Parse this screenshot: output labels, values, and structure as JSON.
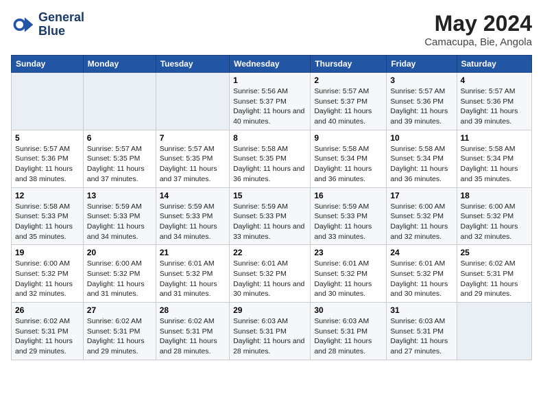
{
  "header": {
    "logo_line1": "General",
    "logo_line2": "Blue",
    "title": "May 2024",
    "subtitle": "Camacupa, Bie, Angola"
  },
  "days_of_week": [
    "Sunday",
    "Monday",
    "Tuesday",
    "Wednesday",
    "Thursday",
    "Friday",
    "Saturday"
  ],
  "weeks": [
    [
      {
        "day": "",
        "info": ""
      },
      {
        "day": "",
        "info": ""
      },
      {
        "day": "",
        "info": ""
      },
      {
        "day": "1",
        "info": "Sunrise: 5:56 AM\nSunset: 5:37 PM\nDaylight: 11 hours and 40 minutes."
      },
      {
        "day": "2",
        "info": "Sunrise: 5:57 AM\nSunset: 5:37 PM\nDaylight: 11 hours and 40 minutes."
      },
      {
        "day": "3",
        "info": "Sunrise: 5:57 AM\nSunset: 5:36 PM\nDaylight: 11 hours and 39 minutes."
      },
      {
        "day": "4",
        "info": "Sunrise: 5:57 AM\nSunset: 5:36 PM\nDaylight: 11 hours and 39 minutes."
      }
    ],
    [
      {
        "day": "5",
        "info": "Sunrise: 5:57 AM\nSunset: 5:36 PM\nDaylight: 11 hours and 38 minutes."
      },
      {
        "day": "6",
        "info": "Sunrise: 5:57 AM\nSunset: 5:35 PM\nDaylight: 11 hours and 37 minutes."
      },
      {
        "day": "7",
        "info": "Sunrise: 5:57 AM\nSunset: 5:35 PM\nDaylight: 11 hours and 37 minutes."
      },
      {
        "day": "8",
        "info": "Sunrise: 5:58 AM\nSunset: 5:35 PM\nDaylight: 11 hours and 36 minutes."
      },
      {
        "day": "9",
        "info": "Sunrise: 5:58 AM\nSunset: 5:34 PM\nDaylight: 11 hours and 36 minutes."
      },
      {
        "day": "10",
        "info": "Sunrise: 5:58 AM\nSunset: 5:34 PM\nDaylight: 11 hours and 36 minutes."
      },
      {
        "day": "11",
        "info": "Sunrise: 5:58 AM\nSunset: 5:34 PM\nDaylight: 11 hours and 35 minutes."
      }
    ],
    [
      {
        "day": "12",
        "info": "Sunrise: 5:58 AM\nSunset: 5:33 PM\nDaylight: 11 hours and 35 minutes."
      },
      {
        "day": "13",
        "info": "Sunrise: 5:59 AM\nSunset: 5:33 PM\nDaylight: 11 hours and 34 minutes."
      },
      {
        "day": "14",
        "info": "Sunrise: 5:59 AM\nSunset: 5:33 PM\nDaylight: 11 hours and 34 minutes."
      },
      {
        "day": "15",
        "info": "Sunrise: 5:59 AM\nSunset: 5:33 PM\nDaylight: 11 hours and 33 minutes."
      },
      {
        "day": "16",
        "info": "Sunrise: 5:59 AM\nSunset: 5:33 PM\nDaylight: 11 hours and 33 minutes."
      },
      {
        "day": "17",
        "info": "Sunrise: 6:00 AM\nSunset: 5:32 PM\nDaylight: 11 hours and 32 minutes."
      },
      {
        "day": "18",
        "info": "Sunrise: 6:00 AM\nSunset: 5:32 PM\nDaylight: 11 hours and 32 minutes."
      }
    ],
    [
      {
        "day": "19",
        "info": "Sunrise: 6:00 AM\nSunset: 5:32 PM\nDaylight: 11 hours and 32 minutes."
      },
      {
        "day": "20",
        "info": "Sunrise: 6:00 AM\nSunset: 5:32 PM\nDaylight: 11 hours and 31 minutes."
      },
      {
        "day": "21",
        "info": "Sunrise: 6:01 AM\nSunset: 5:32 PM\nDaylight: 11 hours and 31 minutes."
      },
      {
        "day": "22",
        "info": "Sunrise: 6:01 AM\nSunset: 5:32 PM\nDaylight: 11 hours and 30 minutes."
      },
      {
        "day": "23",
        "info": "Sunrise: 6:01 AM\nSunset: 5:32 PM\nDaylight: 11 hours and 30 minutes."
      },
      {
        "day": "24",
        "info": "Sunrise: 6:01 AM\nSunset: 5:32 PM\nDaylight: 11 hours and 30 minutes."
      },
      {
        "day": "25",
        "info": "Sunrise: 6:02 AM\nSunset: 5:31 PM\nDaylight: 11 hours and 29 minutes."
      }
    ],
    [
      {
        "day": "26",
        "info": "Sunrise: 6:02 AM\nSunset: 5:31 PM\nDaylight: 11 hours and 29 minutes."
      },
      {
        "day": "27",
        "info": "Sunrise: 6:02 AM\nSunset: 5:31 PM\nDaylight: 11 hours and 29 minutes."
      },
      {
        "day": "28",
        "info": "Sunrise: 6:02 AM\nSunset: 5:31 PM\nDaylight: 11 hours and 28 minutes."
      },
      {
        "day": "29",
        "info": "Sunrise: 6:03 AM\nSunset: 5:31 PM\nDaylight: 11 hours and 28 minutes."
      },
      {
        "day": "30",
        "info": "Sunrise: 6:03 AM\nSunset: 5:31 PM\nDaylight: 11 hours and 28 minutes."
      },
      {
        "day": "31",
        "info": "Sunrise: 6:03 AM\nSunset: 5:31 PM\nDaylight: 11 hours and 27 minutes."
      },
      {
        "day": "",
        "info": ""
      }
    ]
  ]
}
